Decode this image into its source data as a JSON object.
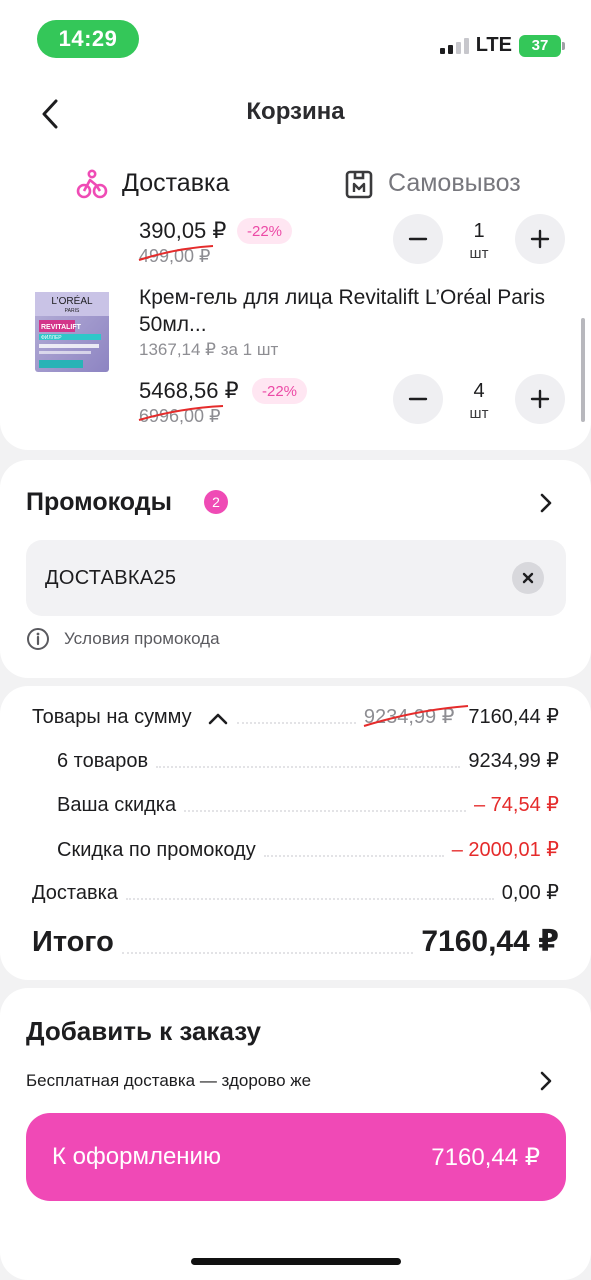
{
  "status_bar": {
    "time": "14:29",
    "network": "LTE",
    "battery": "37"
  },
  "header": {
    "title": "Корзина"
  },
  "tabs": [
    {
      "label": "Доставка",
      "icon": "bicycle-courier-icon",
      "active": true
    },
    {
      "label": "Самовывоз",
      "icon": "parcel-locker-icon",
      "active": false
    }
  ],
  "items": [
    {
      "price": "390,05 ₽",
      "old_price": "499,00 ₽",
      "discount": "-22%",
      "qty": "1",
      "unit": "шт"
    },
    {
      "name": "Крем-гель для лица Revitalift L’Oréal Paris 50мл...",
      "unit_price": "1367,14 ₽ за 1 шт",
      "price": "5468,56 ₽",
      "old_price": "6996,00 ₽",
      "discount": "-22%",
      "qty": "4",
      "unit": "шт",
      "image": {
        "brand": "L’ORÉAL",
        "sub": "PARIS",
        "line": "REVITALIFT",
        "tag": "ФИЛЛЕР"
      }
    }
  ],
  "promo": {
    "title": "Промокоды",
    "count": "2",
    "code": "ДОСТАВКА25",
    "conditions": "Условия промокода"
  },
  "summary": {
    "goods_label": "Товары на сумму",
    "goods_old": "9234,99 ₽",
    "goods_total": "7160,44 ₽",
    "rows": [
      {
        "label": "6 товаров",
        "value": "9234,99 ₽"
      },
      {
        "label": "Ваша скидка",
        "value": "– 74,54 ₽"
      },
      {
        "label": "Скидка по промокоду",
        "value": "– 2000,01 ₽"
      }
    ],
    "delivery_label": "Доставка",
    "delivery_value": "0,00 ₽",
    "total_label": "Итого",
    "total_value": "7160,44 ₽"
  },
  "add_to_order": {
    "title": "Добавить к заказу",
    "free_delivery": "Бесплатная доставка — здорово же"
  },
  "checkout": {
    "label": "К оформлению",
    "amount": "7160,44 ₽"
  },
  "colors": {
    "accent": "#f049b6",
    "discount_red": "#e52b2b",
    "status_green": "#34c759"
  }
}
